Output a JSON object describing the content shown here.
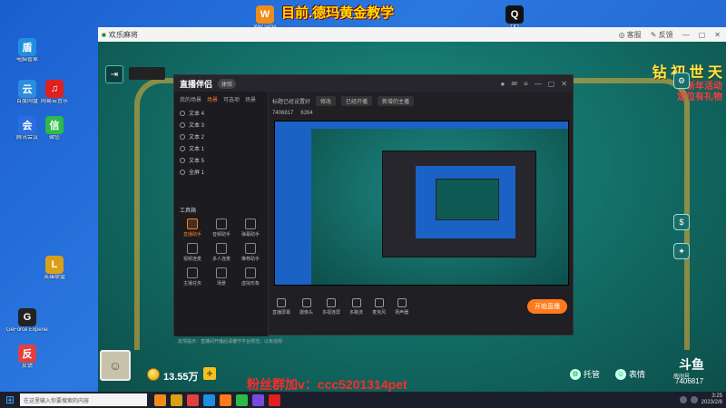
{
  "overlay": {
    "title": "目前.德玛黄金教学",
    "fans": "粉丝群加v：ccc5201314pet"
  },
  "desktop": {
    "icons": [
      {
        "label": "电脑管家",
        "color": "#1e8fe0",
        "glyph": "盾"
      },
      {
        "label": "百度网盘",
        "color": "#2a8de0",
        "glyph": "云"
      },
      {
        "label": "网易云音乐",
        "color": "#e02020",
        "glyph": "♫"
      },
      {
        "label": "腾讯会议",
        "color": "#2a6de0",
        "glyph": "会"
      },
      {
        "label": "微信",
        "color": "#2dbb48",
        "glyph": "信"
      },
      {
        "label": "GeForce Experience",
        "color": "#222",
        "glyph": "G"
      },
      {
        "label": "英雄联盟",
        "color": "#d8a018",
        "glyph": "L"
      },
      {
        "label": "反馈",
        "color": "#e04040",
        "glyph": "反"
      },
      {
        "label": "WeGame",
        "color": "#f08c1a",
        "glyph": "W"
      },
      {
        "label": "QQ",
        "color": "#111",
        "glyph": "Q"
      }
    ]
  },
  "game": {
    "window_title": "欢乐麻将",
    "service": "客服",
    "feedback": "反馈",
    "promo1": "钻 初 世 天",
    "promo2": "新年活动",
    "promo3": "定位有礼物",
    "coins": "13.55万",
    "coin_add": "+",
    "tuoguan": "托管",
    "biaoqing": "表情",
    "douyu": "斗鱼",
    "douyu_sub": "房间号",
    "room_id": "7406817"
  },
  "stream_app": {
    "logo": "直播伴侣",
    "badge": "体验",
    "tabs": [
      "我的场景",
      "场景",
      "可选项",
      "场景"
    ],
    "sources": [
      "文本 4",
      "文本 3",
      "文本 2",
      "文本 1",
      "文本 5",
      "全屏 1"
    ],
    "tools_title": "工具箱",
    "tools": [
      {
        "label": "直播助手",
        "active": true
      },
      {
        "label": "音频助手",
        "active": false
      },
      {
        "label": "弹幕助手",
        "active": false
      },
      {
        "label": "视频连麦",
        "active": false
      },
      {
        "label": "多人连麦",
        "active": false
      },
      {
        "label": "推荐助手",
        "active": false
      },
      {
        "label": "主播任务",
        "active": false
      },
      {
        "label": "场景",
        "active": false
      },
      {
        "label": "虚拟形象",
        "active": false
      }
    ],
    "notice": "友情提示：直播间开播后请遵守平台规范，以免违规",
    "top_left": "标题已经设置好",
    "top_pill": "修改",
    "top_mid": "已经开播",
    "top_right": "新增的主播",
    "info_room": "7406817",
    "info_fans": "6264",
    "bottom": [
      "直播屏幕",
      "摄像头",
      "多视连屏",
      "多路流",
      "麦克风",
      "扬声器"
    ],
    "go_live": "开始直播"
  },
  "taskbar": {
    "search": "在这里输入你要搜索的内容",
    "time": "3:25",
    "date": "2023/2/8"
  }
}
